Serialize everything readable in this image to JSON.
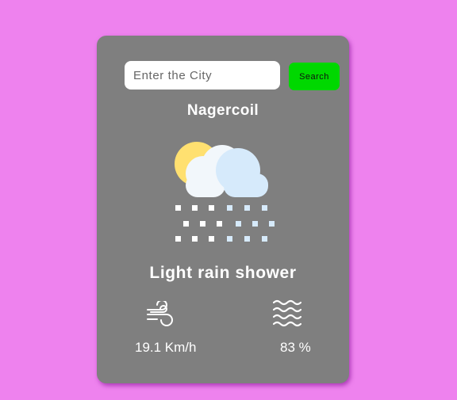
{
  "search": {
    "placeholder": "Enter the City",
    "button_label": "Search"
  },
  "weather": {
    "city": "Nagercoil",
    "condition": "Light rain shower",
    "icon": "sun-cloud-rain-icon",
    "wind": {
      "icon": "wind-icon",
      "value": "19.1 Km/h"
    },
    "humidity": {
      "icon": "humidity-waves-icon",
      "value": "83 %"
    }
  },
  "colors": {
    "page_background": "#ee82ee",
    "card_background": "#7f7f7f",
    "search_button": "#00d800",
    "text": "#ffffff"
  }
}
